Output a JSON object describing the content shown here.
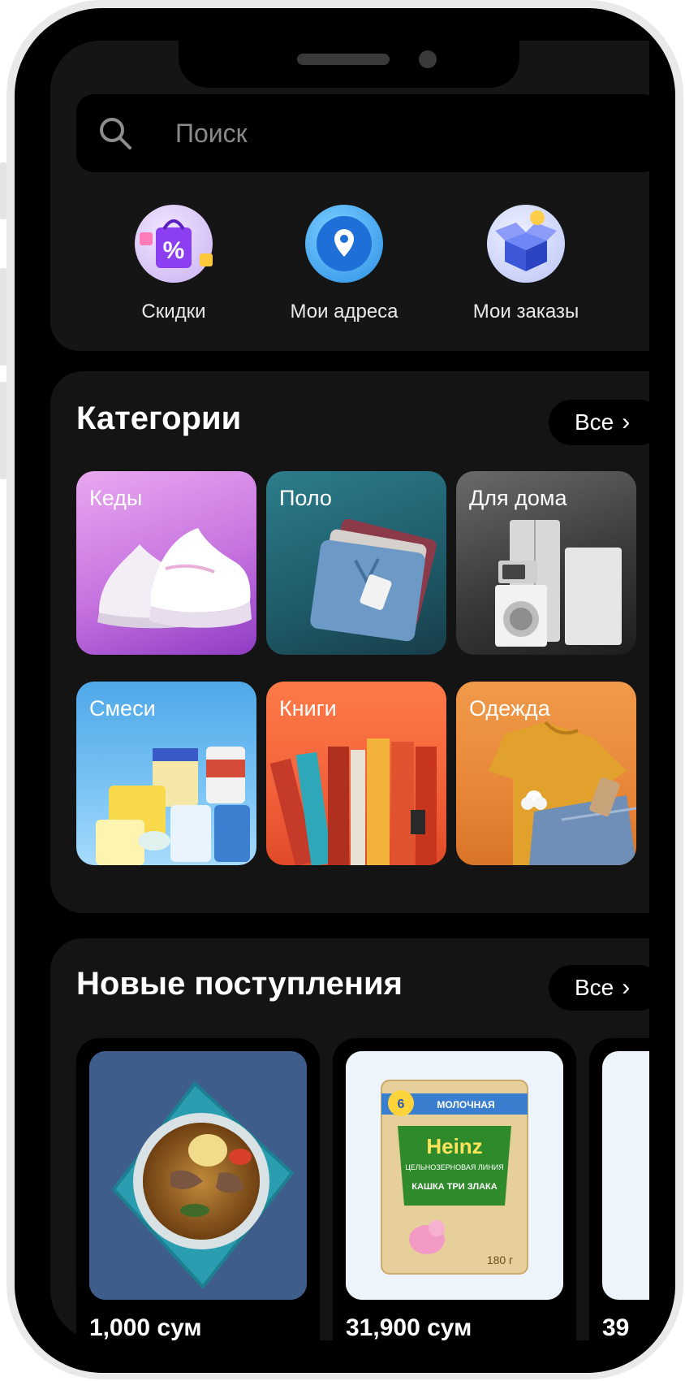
{
  "search": {
    "placeholder": "Поиск"
  },
  "quick_actions": [
    {
      "label": "Скидки",
      "icon": "discount-bag-icon"
    },
    {
      "label": "Мои адреса",
      "icon": "location-pin-icon"
    },
    {
      "label": "Мои заказы",
      "icon": "box-icon"
    }
  ],
  "categories": {
    "title": "Категории",
    "all_label": "Все",
    "items": [
      {
        "label": "Кеды"
      },
      {
        "label": "Поло"
      },
      {
        "label": "Для дома"
      },
      {
        "label": "Смеси"
      },
      {
        "label": "Книги"
      },
      {
        "label": "Одежда"
      }
    ]
  },
  "new_arrivals": {
    "title": "Новые поступления",
    "all_label": "Все",
    "products": [
      {
        "price": "1,000 сум"
      },
      {
        "price": "31,900 сум",
        "package": {
          "brand": "Heinz",
          "badge": "МОЛОЧНАЯ",
          "age": "6",
          "line": "ЦЕЛЬНОЗЕРНОВАЯ ЛИНИЯ",
          "name": "КАШКА ТРИ ЗЛАКА",
          "weight": "180 г"
        }
      },
      {
        "price": "39"
      }
    ]
  }
}
